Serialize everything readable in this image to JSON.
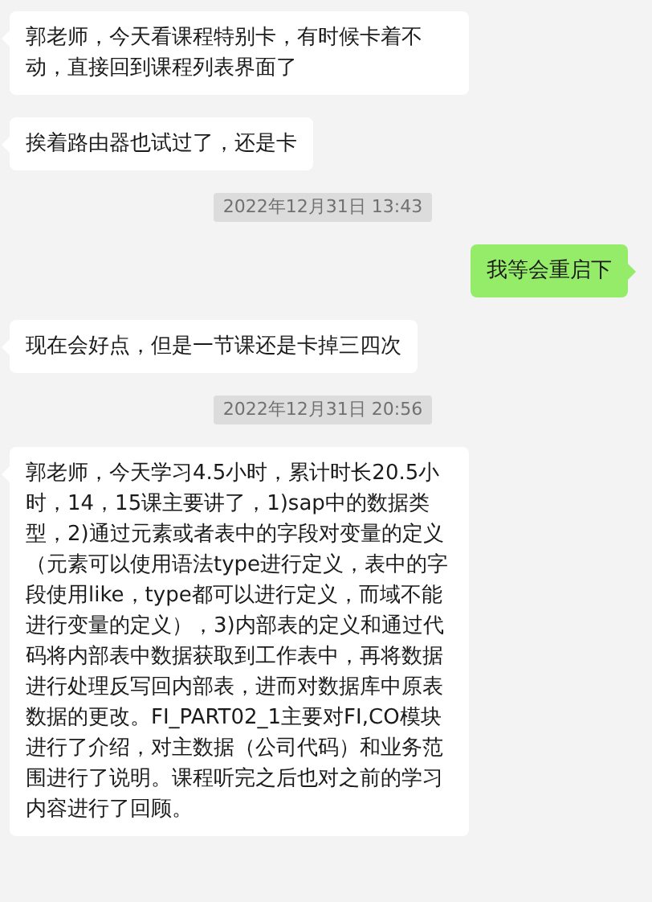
{
  "messages": [
    {
      "kind": "incoming",
      "text": "郭老师，今天看课程特别卡，有时候卡着不动，直接回到课程列表界面了"
    },
    {
      "kind": "incoming",
      "text": "挨着路由器也试过了，还是卡"
    },
    {
      "kind": "timestamp",
      "text": "2022年12月31日 13:43"
    },
    {
      "kind": "outgoing",
      "text": "我等会重启下"
    },
    {
      "kind": "incoming",
      "text": "现在会好点，但是一节课还是卡掉三四次"
    },
    {
      "kind": "timestamp",
      "text": "2022年12月31日 20:56"
    },
    {
      "kind": "incoming",
      "text": "郭老师，今天学习4.5小时，累计时长20.5小时，14，15课主要讲了，1)sap中的数据类型，2)通过元素或者表中的字段对变量的定义（元素可以使用语法type进行定义，表中的字段使用like，type都可以进行定义，而域不能进行变量的定义），3)内部表的定义和通过代码将内部表中数据获取到工作表中，再将数据进行处理反写回内部表，进而对数据库中原表数据的更改。FI_PART02_1主要对FI,CO模块进行了介绍，对主数据（公司代码）和业务范围进行了说明。课程听完之后也对之前的学习内容进行了回顾。"
    }
  ]
}
